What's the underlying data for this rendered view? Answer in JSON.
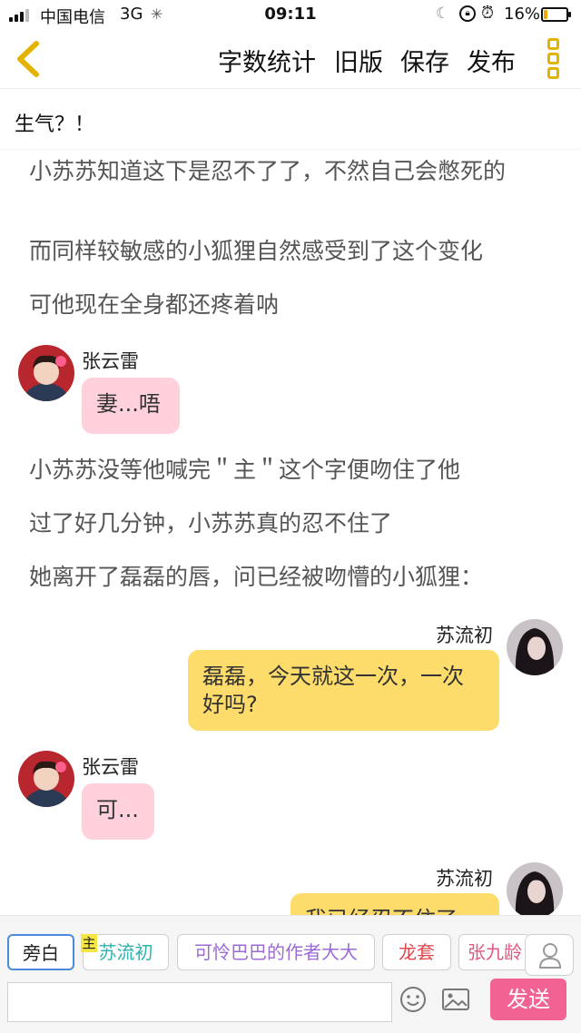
{
  "status_bar": {
    "carrier": "中国电信",
    "network": "3G",
    "time": "09:11",
    "battery": "16%",
    "battery_level": 0.16
  },
  "toolbar": {
    "word_count": "字数统计",
    "old_version": "旧版",
    "save": "保存",
    "publish": "发布"
  },
  "chapter_title": "生气？！",
  "story": {
    "narration_1": "小苏苏知道这下是忍不了了，不然自己会憋死的",
    "narration_2": "而同样较敏感的小狐狸自然感受到了这个变化",
    "narration_3": "可他现在全身都还疼着呐",
    "msg_1": {
      "speaker": "张云雷",
      "text": "妻...唔"
    },
    "narration_4": "小苏苏没等他喊完＂主＂这个字便吻住了他",
    "narration_5": "过了好几分钟，小苏苏真的忍不住了",
    "narration_6": "她离开了磊磊的唇，问已经被吻懵的小狐狸：",
    "msg_2": {
      "speaker": "苏流初",
      "text": "磊磊，今天就这一次，一次好吗?"
    },
    "msg_3": {
      "speaker": "张云雷",
      "text": "可..."
    },
    "msg_4": {
      "speaker": "苏流初",
      "text": "我已经忍不住了"
    }
  },
  "character_bar": {
    "narrator": "旁白",
    "main_badge": "主",
    "chars": [
      "苏流初",
      "可怜巴巴的作者大大",
      "龙套",
      "张九龄"
    ]
  },
  "input_bar": {
    "placeholder": "",
    "send": "发送"
  },
  "colors": {
    "accent_yellow": "#e2b400",
    "pink_bubble": "#ffd1dc",
    "yellow_bubble": "#fddc6b",
    "send_button": "#f06392"
  }
}
